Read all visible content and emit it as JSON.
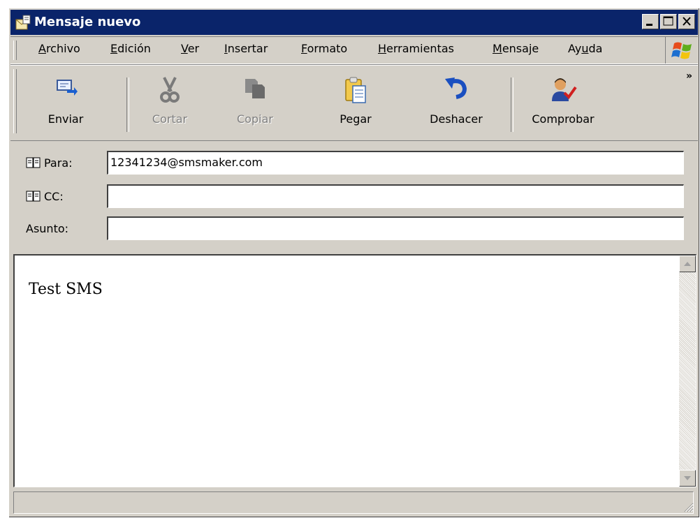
{
  "window": {
    "title": "Mensaje nuevo"
  },
  "menu": {
    "items": [
      {
        "pre": "",
        "u": "A",
        "post": "rchivo"
      },
      {
        "pre": "",
        "u": "E",
        "post": "dición"
      },
      {
        "pre": "",
        "u": "V",
        "post": "er"
      },
      {
        "pre": "",
        "u": "I",
        "post": "nsertar"
      },
      {
        "pre": "",
        "u": "F",
        "post": "ormato"
      },
      {
        "pre": "",
        "u": "H",
        "post": "erramientas"
      },
      {
        "pre": "",
        "u": "M",
        "post": "ensaje"
      },
      {
        "pre": "Ay",
        "u": "u",
        "post": "da"
      }
    ]
  },
  "toolbar": {
    "send": "Enviar",
    "cut": "Cortar",
    "copy": "Copiar",
    "paste": "Pegar",
    "undo": "Deshacer",
    "check": "Comprobar",
    "more": "»"
  },
  "fields": {
    "to_label": "Para:",
    "to_value": "12341234@smsmaker.com",
    "cc_label": "CC:",
    "cc_value": "",
    "subject_label": "Asunto:",
    "subject_value": ""
  },
  "body": {
    "text": "Test SMS"
  },
  "colors": {
    "titlebar": "#0a246a",
    "chrome": "#d4d0c8"
  }
}
